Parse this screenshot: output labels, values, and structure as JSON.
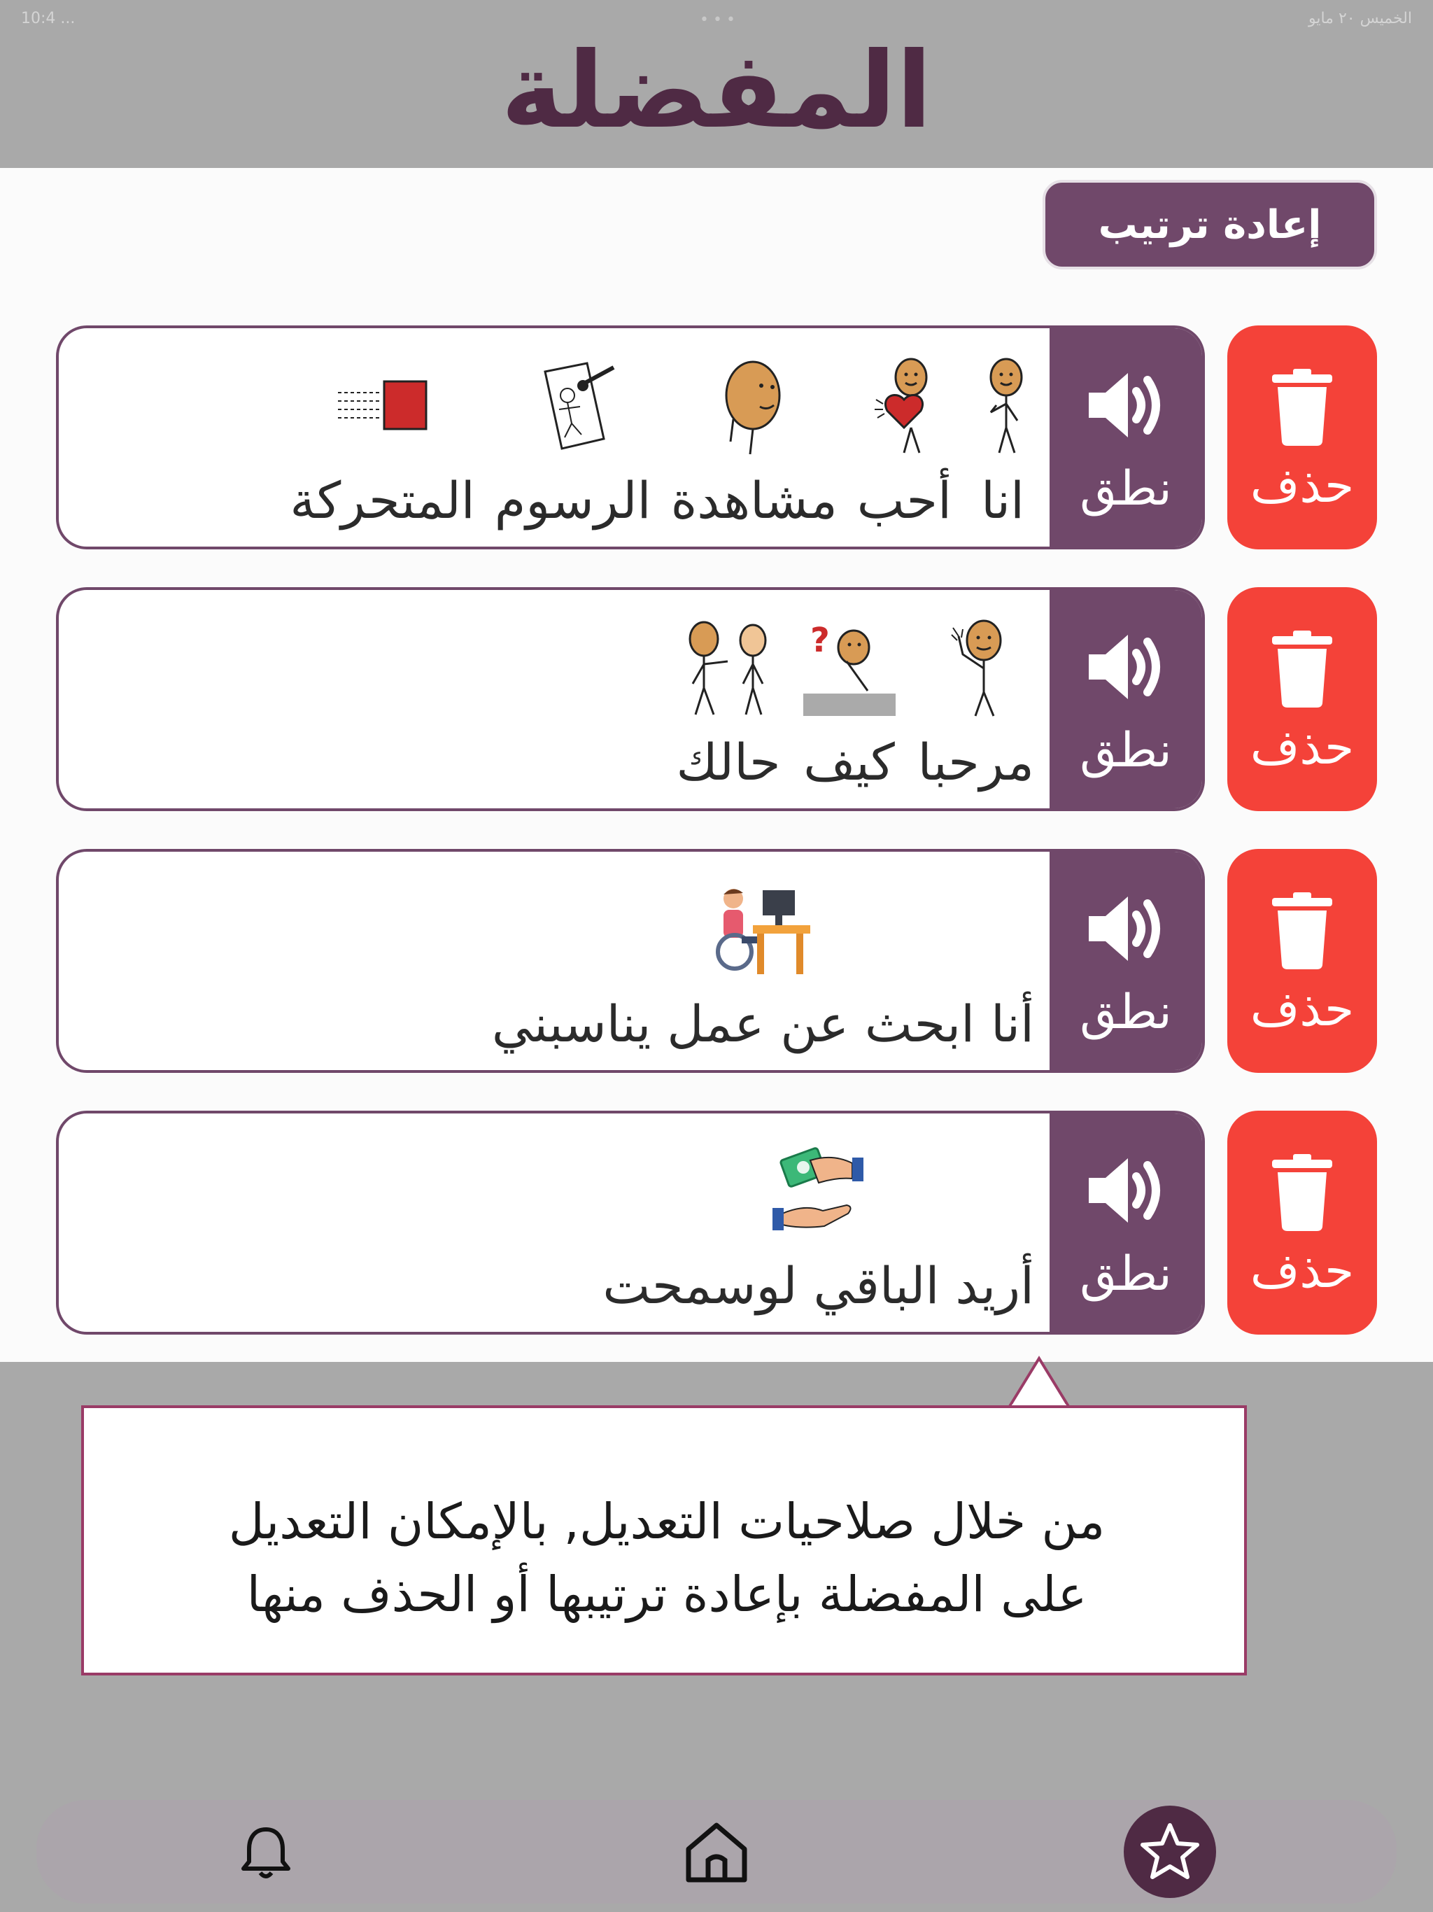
{
  "status_bar": {
    "left": "10:4 ...",
    "right": "الخميس ٢٠ مايو"
  },
  "header": {
    "title": "المفضلة"
  },
  "toolbar": {
    "reorder_label": "إعادة ترتيب"
  },
  "colors": {
    "primary": "#70486a",
    "title": "#4f2a44",
    "delete": "#f44239",
    "callout_border": "#9a3b66"
  },
  "favorites": [
    {
      "delete_label": "حذف",
      "speak_label": "نطق",
      "symbols": [
        {
          "word": "انا",
          "icon": "me-person-icon"
        },
        {
          "word": "أحب",
          "icon": "love-heart-icon"
        },
        {
          "word": "مشاهدة",
          "icon": "watch-face-icon"
        },
        {
          "word": "الرسوم",
          "icon": "drawing-icon"
        },
        {
          "word": "المتحركة",
          "icon": "animation-icon"
        }
      ]
    },
    {
      "delete_label": "حذف",
      "speak_label": "نطق",
      "symbols": [
        {
          "word": "مرحبا",
          "icon": "wave-hello-icon"
        },
        {
          "word": "كيف",
          "icon": "question-person-icon"
        },
        {
          "word": "حالك",
          "icon": "two-people-icon"
        }
      ]
    },
    {
      "delete_label": "حذف",
      "speak_label": "نطق",
      "symbols": [
        {
          "word": "أنا ابحث عن عمل يناسبني",
          "icon": "wheelchair-computer-icon"
        }
      ]
    },
    {
      "delete_label": "حذف",
      "speak_label": "نطق",
      "symbols": [
        {
          "word": "أريد الباقي لوسمحت",
          "icon": "money-hands-icon"
        }
      ]
    }
  ],
  "callout": {
    "line1": "من خلال صلاحيات التعديل, بالإمكان التعديل",
    "line2": "على المفضلة بإعادة ترتيبها أو الحذف منها"
  },
  "nav": {
    "items": [
      "bell-icon",
      "home-icon",
      "star-icon"
    ]
  }
}
